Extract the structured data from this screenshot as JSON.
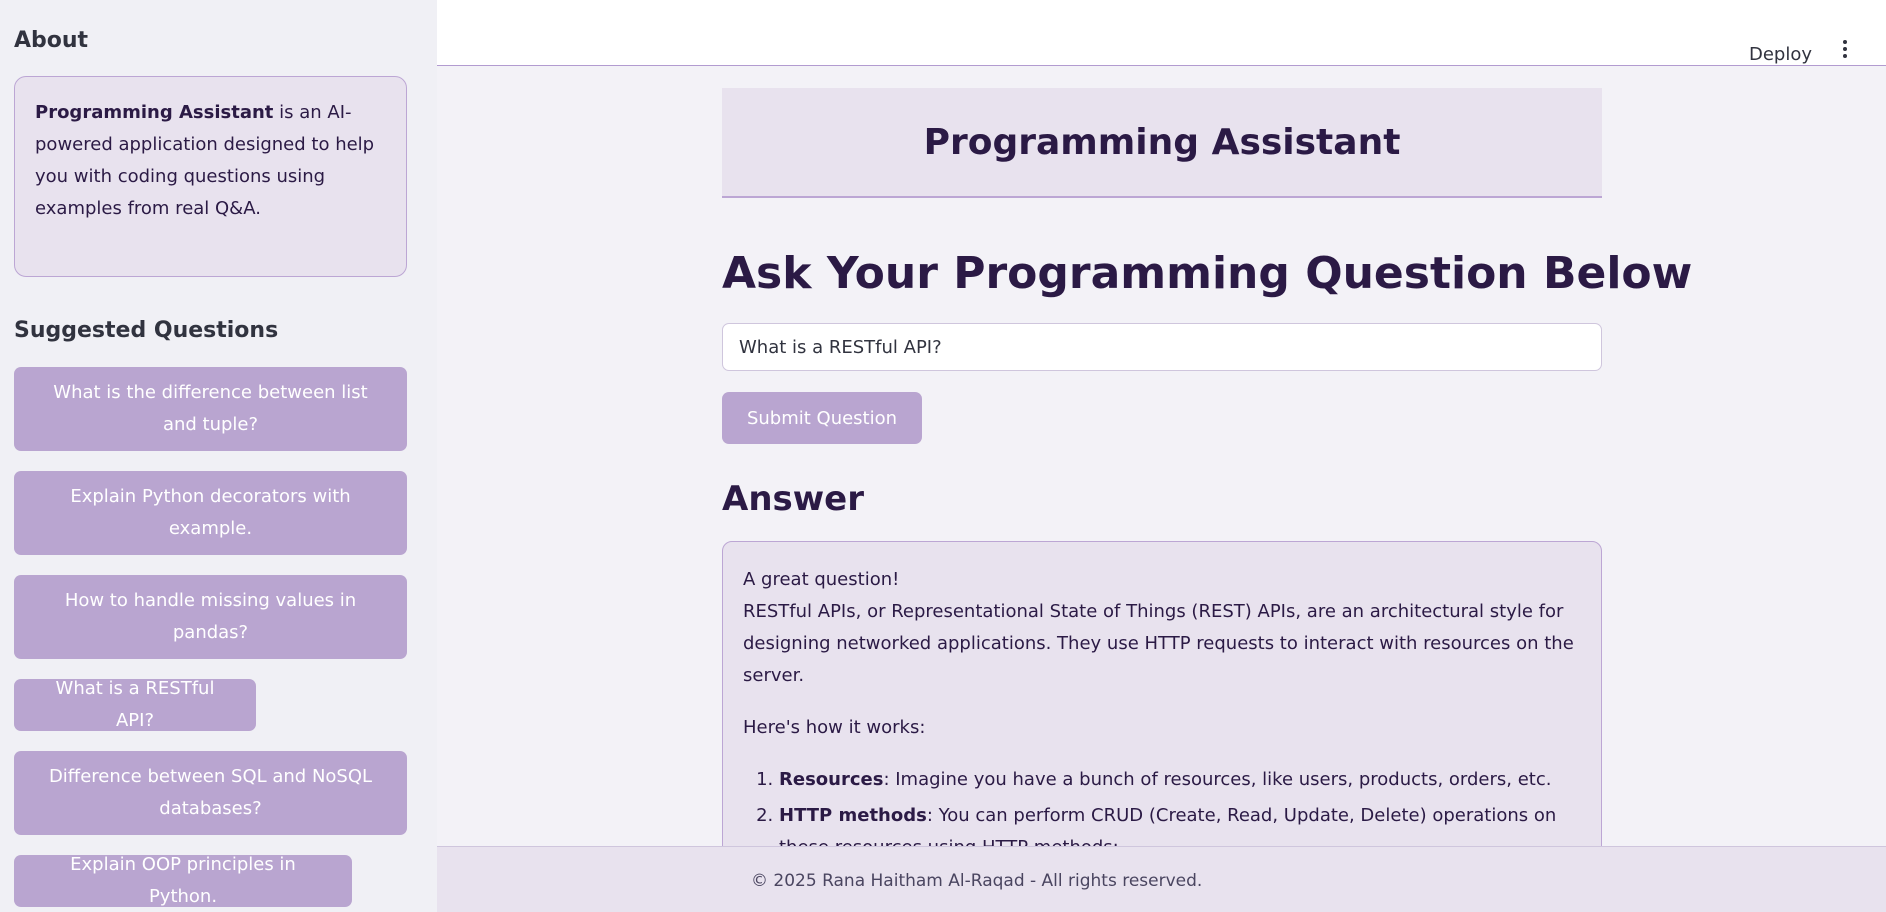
{
  "sidebar": {
    "about_heading": "About",
    "about_bold": "Programming Assistant",
    "about_text": " is an AI-powered application designed to help you with coding questions using examples from real Q&A.",
    "suggested_heading": "Suggested Questions",
    "suggested": [
      "What is the difference between list and tuple?",
      "Explain Python decorators with example.",
      "How to handle missing values in pandas?",
      "What is a RESTful API?",
      "Difference between SQL and NoSQL databases?",
      "Explain OOP principles in Python."
    ]
  },
  "topbar": {
    "deploy_label": "Deploy"
  },
  "main": {
    "banner_title": "Programming Assistant",
    "ask_heading": "Ask Your Programming Question Below",
    "question_value": "What is a RESTful API?",
    "submit_label": "Submit Question",
    "answer_heading": "Answer",
    "answer": {
      "intro_line1": "A great question!",
      "intro_line2": "RESTful APIs, or Representational State of Things (REST) APIs, are an architectural style for designing networked applications. They use HTTP requests to interact with resources on the server.",
      "how_it_works": "Here's how it works:",
      "items": [
        {
          "bold": "Resources",
          "text": ": Imagine you have a bunch of resources, like users, products, orders, etc."
        },
        {
          "bold": "HTTP methods",
          "text": ": You can perform CRUD (Create, Read, Update, Delete) operations on these resources using HTTP methods:"
        }
      ]
    }
  },
  "footer": {
    "text": "© 2025 Rana Haitham Al-Raqad - All rights reserved."
  }
}
